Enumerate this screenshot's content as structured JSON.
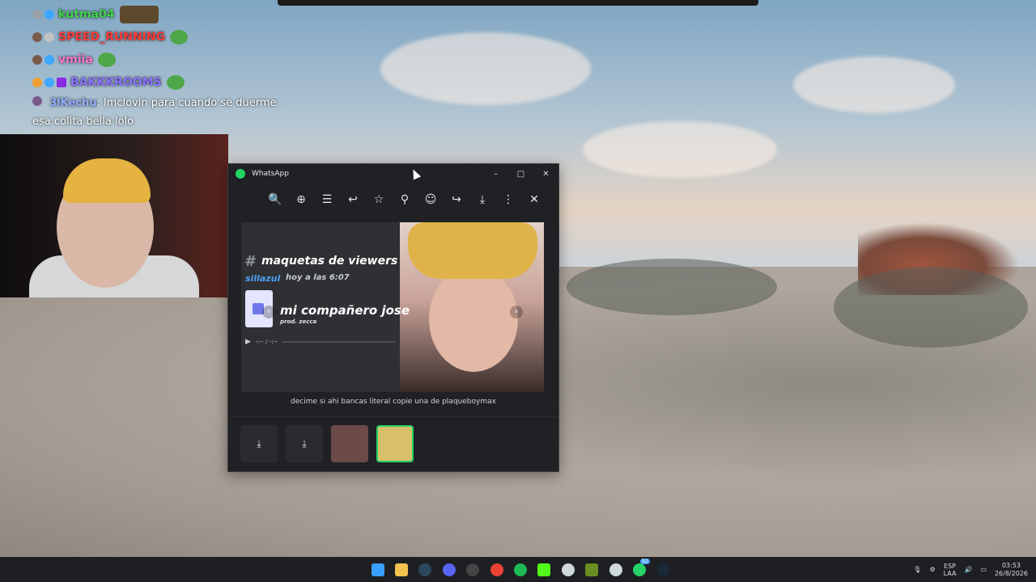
{
  "chat": {
    "messages": [
      {
        "user": "kutma04",
        "color": "#43d14d",
        "emote": "img"
      },
      {
        "user": "SPEED_RUNNING",
        "color": "#ff3b3b",
        "emote": "pepe"
      },
      {
        "user": "vmiia",
        "color": "#ff77cc",
        "emote": "pepe"
      },
      {
        "user": "BAKKKROOMS",
        "color": "#8a73ff",
        "emote": "pepe"
      }
    ],
    "last": {
      "user": "3lKechu",
      "color": "#8faeff",
      "text": "lmclovin para cuando se duerme",
      "text2": "esa colita bella lolo"
    }
  },
  "whatsapp": {
    "title": "WhatsApp",
    "window_controls": {
      "minimize": "–",
      "maximize": "□",
      "close": "✕"
    },
    "toolbar": {
      "zoom_out": "🔍",
      "zoom_in": "⊕",
      "caption": "☰",
      "reply": "↩",
      "star": "☆",
      "pin": "⚲",
      "react": "☺",
      "forward": "↪",
      "download": "⤓",
      "more": "⋮",
      "close": "✕"
    },
    "media": {
      "hash": "#",
      "channel": "maquetas de viewers",
      "user": "sillazul",
      "time": "hoy a las 6:07",
      "song": "mi compañero jose",
      "prod": "prod. zecca",
      "player_time": "-:-- / -:--",
      "prev": "‹",
      "next": "›"
    },
    "caption": "decime si ahi bancas literal copie una de plaqueboymax",
    "strip": {
      "download1": "⤓",
      "download2": "⤓"
    }
  },
  "taskbar": {
    "notification": "52",
    "lang1": "ESP",
    "lang2": "LAA",
    "time": "03:53",
    "date": "26/8/2026",
    "apps": [
      {
        "name": "start-menu",
        "color": "#3aa0ff"
      },
      {
        "name": "file-explorer",
        "color": "#f2c14e"
      },
      {
        "name": "steam",
        "color": "#2a475e"
      },
      {
        "name": "discord",
        "color": "#5865f2"
      },
      {
        "name": "obs",
        "color": "#444"
      },
      {
        "name": "chrome",
        "color": "#e94235"
      },
      {
        "name": "spotify",
        "color": "#1db954"
      },
      {
        "name": "kick",
        "color": "#53fc18"
      },
      {
        "name": "ccleaner",
        "color": "#cfd8dc"
      },
      {
        "name": "minecraft",
        "color": "#6b8e23"
      },
      {
        "name": "ccleaner-2",
        "color": "#cfd8dc"
      },
      {
        "name": "whatsapp",
        "color": "#25d366"
      },
      {
        "name": "steam-2",
        "color": "#1b2838"
      }
    ]
  }
}
